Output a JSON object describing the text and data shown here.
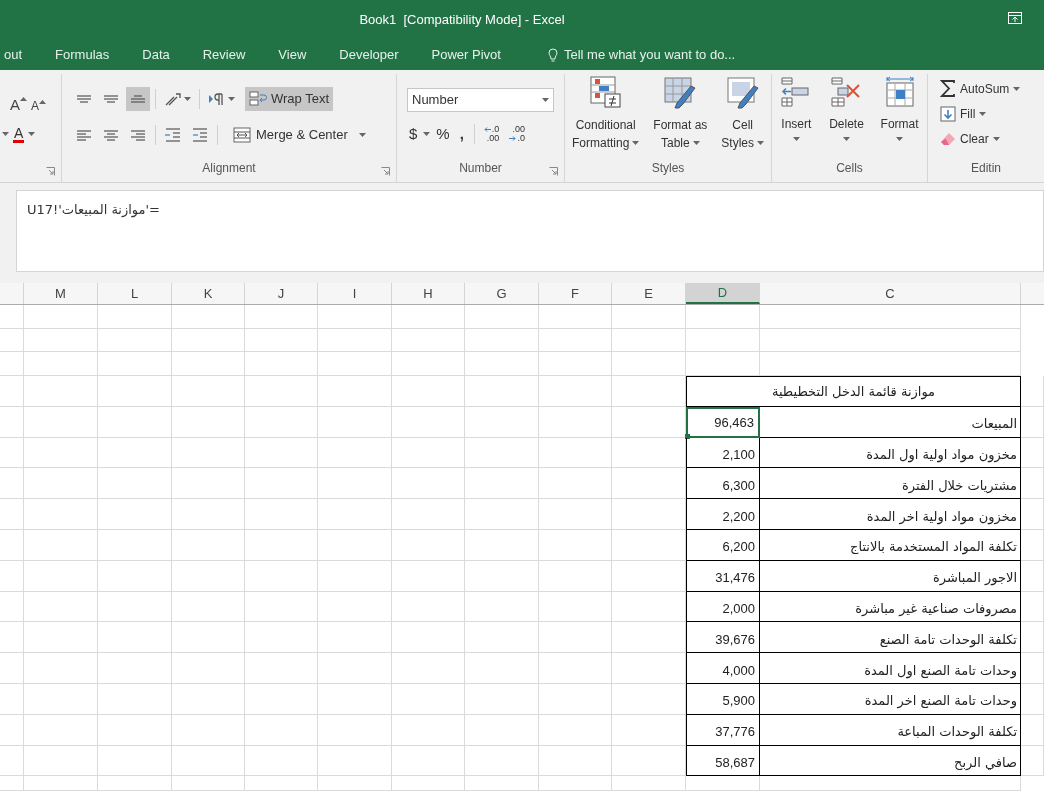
{
  "window": {
    "title": "Book1  [Compatibility Mode] - Excel"
  },
  "tabs": [
    {
      "label": "out"
    },
    {
      "label": "Formulas"
    },
    {
      "label": "Data"
    },
    {
      "label": "Review"
    },
    {
      "label": "View"
    },
    {
      "label": "Developer"
    },
    {
      "label": "Power Pivot"
    }
  ],
  "tell_me": {
    "placeholder": "Tell me what you want to do..."
  },
  "ribbon": {
    "font": {
      "grow_font": "A",
      "shrink_font": "A",
      "font_color": "A"
    },
    "alignment": {
      "label": "Alignment",
      "vertical_align": [
        {
          "selected": false
        },
        {
          "selected": false
        },
        {
          "selected": true
        }
      ],
      "horizontal_align": [
        {
          "selected": false
        },
        {
          "selected": false
        },
        {
          "selected": false
        }
      ],
      "wrap_text": {
        "label": "Wrap Text",
        "selected": true
      },
      "merge_center": {
        "label": "Merge & Center"
      }
    },
    "number": {
      "label": "Number",
      "format": "Number",
      "currency": "$",
      "percent": "%",
      "comma": ",",
      "increase_decimal": {
        "top": ".0",
        "bottom": ".00"
      },
      "decrease_decimal": {
        "top": ".00",
        "bottom": ".0"
      }
    },
    "styles": {
      "label": "Styles",
      "buttons": [
        {
          "lines": [
            "Conditional",
            "Formatting"
          ]
        },
        {
          "lines": [
            "Format as",
            "Table"
          ]
        },
        {
          "lines": [
            "Cell",
            "Styles"
          ]
        }
      ]
    },
    "cells": {
      "label": "Cells",
      "buttons": [
        {
          "label": "Insert"
        },
        {
          "label": "Delete"
        },
        {
          "label": "Format"
        }
      ]
    },
    "editing": {
      "label": "Editin",
      "buttons": [
        {
          "label": "AutoSum"
        },
        {
          "label": "Fill"
        },
        {
          "label": "Clear"
        }
      ]
    }
  },
  "formula_bar": {
    "value": "='موازنة المبيعات'!U17"
  },
  "sheet": {
    "columns": [
      {
        "label": "M",
        "selected": false
      },
      {
        "label": "L",
        "selected": false
      },
      {
        "label": "K",
        "selected": false
      },
      {
        "label": "J",
        "selected": false
      },
      {
        "label": "I",
        "selected": false
      },
      {
        "label": "H",
        "selected": false
      },
      {
        "label": "G",
        "selected": false
      },
      {
        "label": "F",
        "selected": false
      },
      {
        "label": "E",
        "selected": false
      },
      {
        "label": "D",
        "selected": true
      },
      {
        "label": "C",
        "selected": false
      }
    ],
    "table": {
      "title": "موازنة قائمة الدخل التخطيطية",
      "rows": [
        {
          "label": "المبيعات",
          "value": "96,463",
          "selected": true
        },
        {
          "label": "مخزون مواد اولية اول المدة",
          "value": "2,100",
          "selected": false
        },
        {
          "label": "مشتريات خلال الفترة",
          "value": "6,300",
          "selected": false
        },
        {
          "label": "مخزون مواد اولية اخر المدة",
          "value": "2,200",
          "selected": false
        },
        {
          "label": "تكلفة المواد المستخدمة بالانتاج",
          "value": "6,200",
          "selected": false
        },
        {
          "label": "الاجور المباشرة",
          "value": "31,476",
          "selected": false
        },
        {
          "label": "مصروفات صناعية غير مباشرة",
          "value": "2,000",
          "selected": false
        },
        {
          "label": "تكلفة الوحدات تامة الصنع",
          "value": "39,676",
          "selected": false
        },
        {
          "label": "وحدات تامة الصنع اول المدة",
          "value": "4,000",
          "selected": false
        },
        {
          "label": "وحدات تامة الصنع اخر المدة",
          "value": "5,900",
          "selected": false
        },
        {
          "label": "تكلفة الوحدات المباعة",
          "value": "37,776",
          "selected": false
        },
        {
          "label": "صافي الربح",
          "value": "58,687",
          "selected": false
        }
      ]
    }
  }
}
